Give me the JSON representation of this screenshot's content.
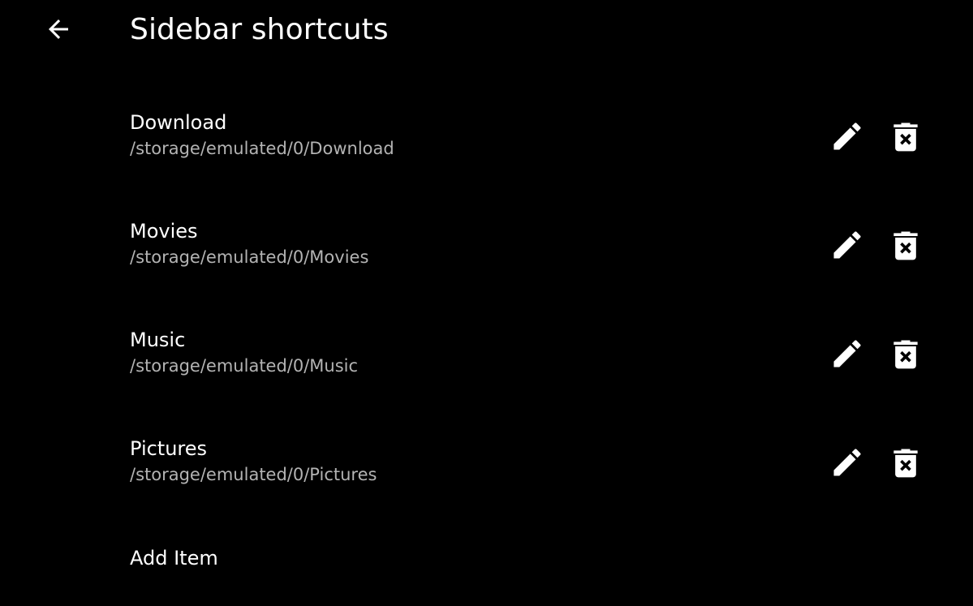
{
  "header": {
    "title": "Sidebar shortcuts",
    "back_icon": "arrow-back-icon"
  },
  "shortcuts": [
    {
      "name": "Download",
      "path": "/storage/emulated/0/Download"
    },
    {
      "name": "Movies",
      "path": "/storage/emulated/0/Movies"
    },
    {
      "name": "Music",
      "path": "/storage/emulated/0/Music"
    },
    {
      "name": "Pictures",
      "path": "/storage/emulated/0/Pictures"
    }
  ],
  "row_icons": {
    "edit": "pencil-icon",
    "delete": "trash-x-icon"
  },
  "add_item_label": "Add Item",
  "colors": {
    "background": "#000000",
    "primary_text": "#ffffff",
    "secondary_text": "#b3b3b3"
  }
}
